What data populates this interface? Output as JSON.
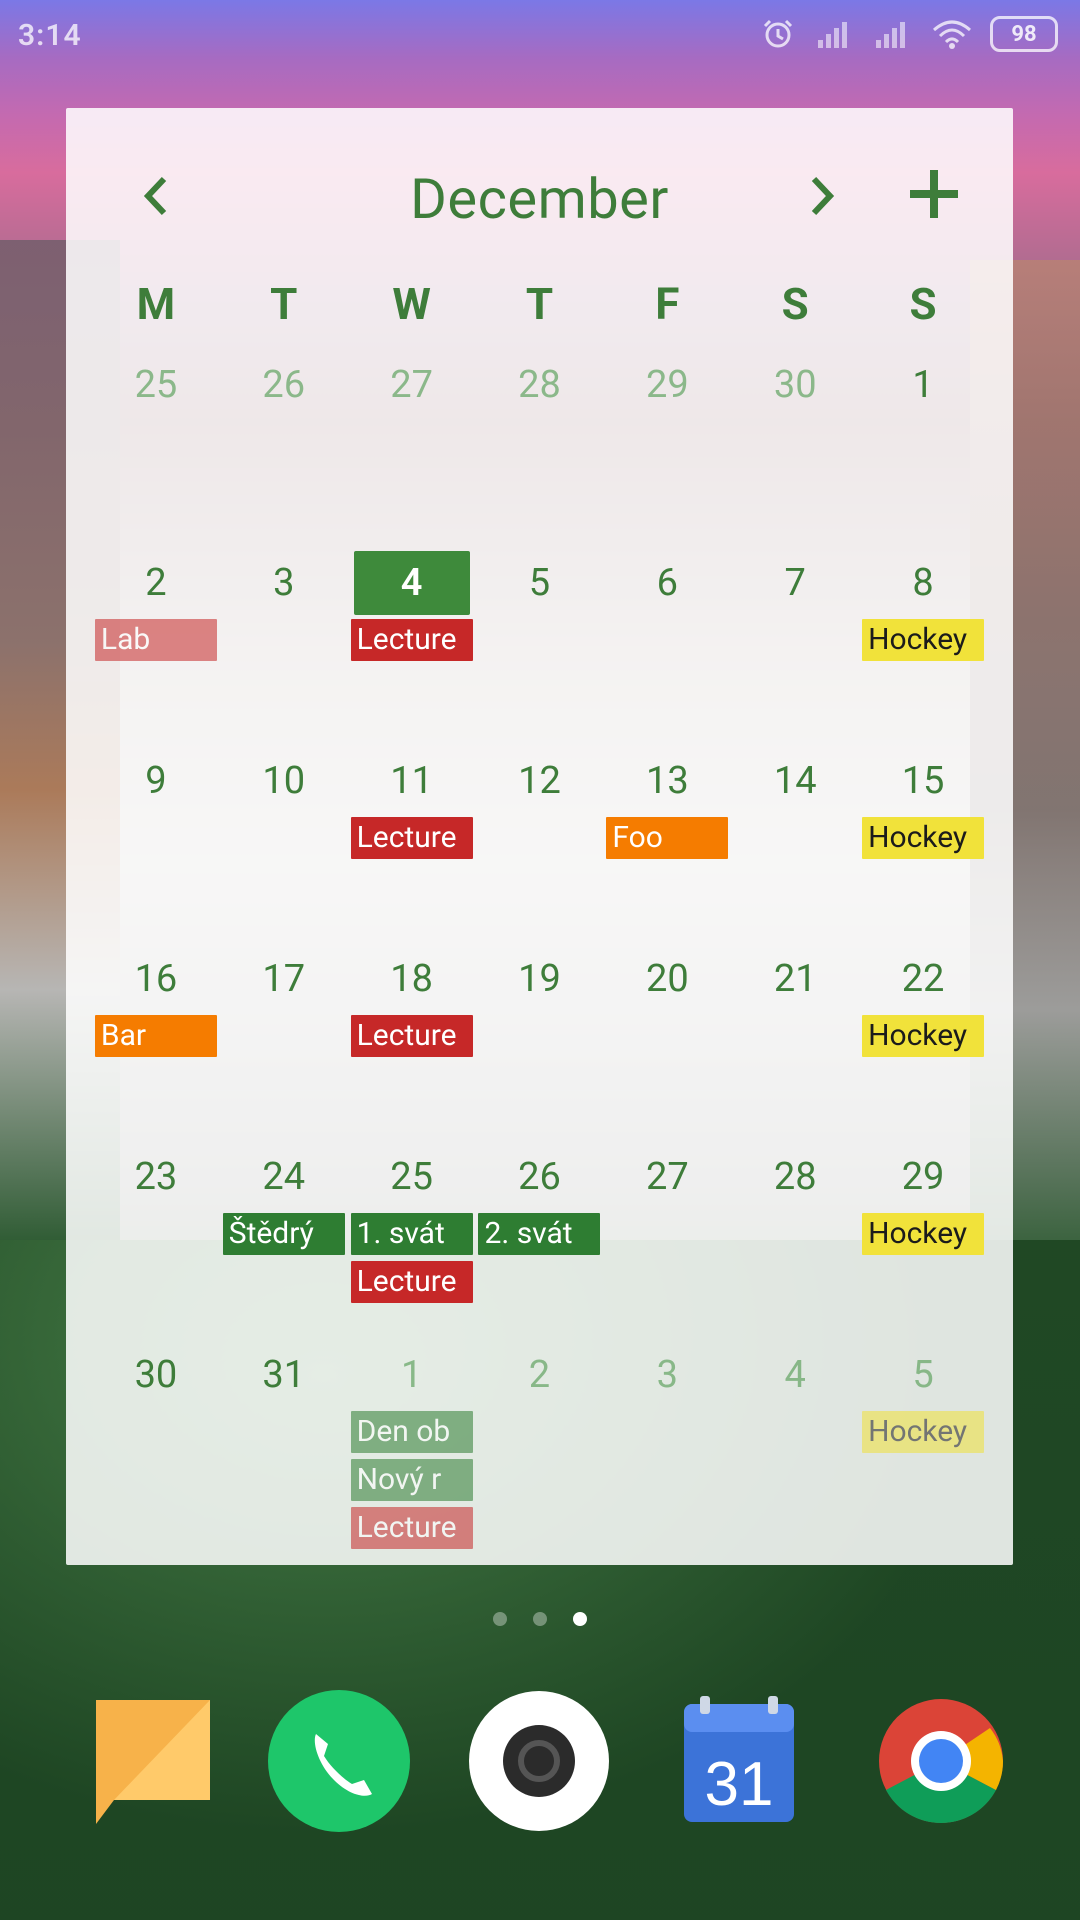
{
  "status_bar": {
    "time": "3:14",
    "battery": "98",
    "icons": [
      "alarm-icon",
      "signal-icon",
      "signal-icon",
      "wifi-icon",
      "battery-icon"
    ]
  },
  "widget": {
    "month": "December",
    "weekdays": [
      "M",
      "T",
      "W",
      "T",
      "F",
      "S",
      "S"
    ],
    "weeks": [
      [
        {
          "day": "25",
          "muted": true,
          "events": []
        },
        {
          "day": "26",
          "muted": true,
          "events": []
        },
        {
          "day": "27",
          "muted": true,
          "events": []
        },
        {
          "day": "28",
          "muted": true,
          "events": []
        },
        {
          "day": "29",
          "muted": true,
          "events": []
        },
        {
          "day": "30",
          "muted": true,
          "events": []
        },
        {
          "day": "1",
          "events": []
        }
      ],
      [
        {
          "day": "2",
          "events": [
            {
              "label": "Lab",
              "color": "red",
              "faded": true
            }
          ]
        },
        {
          "day": "3",
          "events": []
        },
        {
          "day": "4",
          "today": true,
          "events": [
            {
              "label": "Lecture",
              "color": "red"
            }
          ]
        },
        {
          "day": "5",
          "events": []
        },
        {
          "day": "6",
          "events": []
        },
        {
          "day": "7",
          "events": []
        },
        {
          "day": "8",
          "events": [
            {
              "label": "Hockey",
              "color": "yellow"
            }
          ]
        }
      ],
      [
        {
          "day": "9",
          "events": []
        },
        {
          "day": "10",
          "events": []
        },
        {
          "day": "11",
          "events": [
            {
              "label": "Lecture",
              "color": "red"
            }
          ]
        },
        {
          "day": "12",
          "events": []
        },
        {
          "day": "13",
          "events": [
            {
              "label": "Foo",
              "color": "orange"
            }
          ]
        },
        {
          "day": "14",
          "events": []
        },
        {
          "day": "15",
          "events": [
            {
              "label": "Hockey",
              "color": "yellow"
            }
          ]
        }
      ],
      [
        {
          "day": "16",
          "events": [
            {
              "label": "Bar",
              "color": "orange"
            }
          ]
        },
        {
          "day": "17",
          "events": []
        },
        {
          "day": "18",
          "events": [
            {
              "label": "Lecture",
              "color": "red"
            }
          ]
        },
        {
          "day": "19",
          "events": []
        },
        {
          "day": "20",
          "events": []
        },
        {
          "day": "21",
          "events": []
        },
        {
          "day": "22",
          "events": [
            {
              "label": "Hockey",
              "color": "yellow"
            }
          ]
        }
      ],
      [
        {
          "day": "23",
          "events": []
        },
        {
          "day": "24",
          "events": [
            {
              "label": "Štědrý",
              "color": "green"
            }
          ]
        },
        {
          "day": "25",
          "events": [
            {
              "label": "1. svát",
              "color": "green"
            },
            {
              "label": "Lecture",
              "color": "red"
            }
          ]
        },
        {
          "day": "26",
          "events": [
            {
              "label": "2. svát",
              "color": "green"
            }
          ]
        },
        {
          "day": "27",
          "events": []
        },
        {
          "day": "28",
          "events": []
        },
        {
          "day": "29",
          "events": [
            {
              "label": "Hockey",
              "color": "yellow"
            }
          ]
        }
      ],
      [
        {
          "day": "30",
          "events": []
        },
        {
          "day": "31",
          "events": []
        },
        {
          "day": "1",
          "muted": true,
          "events": [
            {
              "label": "Den ob",
              "color": "green",
              "faded": true
            },
            {
              "label": "Nový r",
              "color": "green",
              "faded": true
            },
            {
              "label": "Lecture",
              "color": "red",
              "faded": true
            }
          ]
        },
        {
          "day": "2",
          "muted": true,
          "events": []
        },
        {
          "day": "3",
          "muted": true,
          "events": []
        },
        {
          "day": "4",
          "muted": true,
          "events": []
        },
        {
          "day": "5",
          "muted": true,
          "events": [
            {
              "label": "Hockey",
              "color": "yellow",
              "faded": true
            }
          ]
        }
      ]
    ]
  },
  "dock": {
    "apps": [
      {
        "name": "messages-app",
        "icon": "message-icon"
      },
      {
        "name": "phone-app",
        "icon": "phone-icon"
      },
      {
        "name": "camera-app",
        "icon": "camera-icon"
      },
      {
        "name": "calendar-app",
        "icon": "calendar-icon",
        "label": "31"
      },
      {
        "name": "chrome-app",
        "icon": "chrome-icon"
      }
    ]
  },
  "colors": {
    "green": "#3e7d3a",
    "red": "#c62828",
    "orange": "#f57c00",
    "yellow": "#f1e23a"
  }
}
